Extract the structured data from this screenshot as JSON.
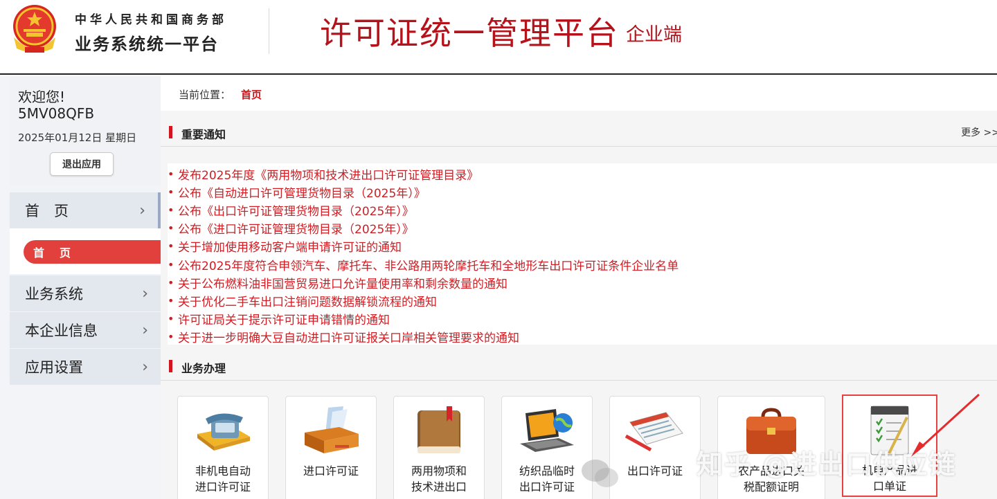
{
  "header": {
    "ministry": "中华人民共和国商务部",
    "platform": "业务系统统一平台",
    "title": "许可证统一管理平台",
    "title_suffix": "企业端"
  },
  "sidebar": {
    "welcome": "欢迎您!",
    "user_id": "5MV08QFB",
    "date": "2025年01月12日 星期日",
    "logout_label": "退出应用",
    "menu": [
      {
        "label": "首　页"
      },
      {
        "label": "业务系统"
      },
      {
        "label": "本企业信息"
      },
      {
        "label": "应用设置"
      }
    ],
    "submenu_active": "首页"
  },
  "breadcrumb": {
    "label": "当前位置：",
    "current": "首页"
  },
  "notices": {
    "title": "重要通知",
    "more": "更多 >>",
    "items": [
      "发布2025年度《两用物项和技术进出口许可证管理目录》",
      "公布《自动进口许可管理货物目录（2025年）》",
      "公布《出口许可证管理货物目录（2025年）》",
      "公布《进口许可证管理货物目录（2025年）》",
      "关于增加使用移动客户端申请许可证的通知",
      "公布2025年度符合申领汽车、摩托车、非公路用两轮摩托车和全地形车出口许可证条件企业名单",
      "关于公布燃料油非国营贸易进口允许量使用率和剩余数量的通知",
      "关于优化二手车出口注销问题数据解锁流程的通知",
      "许可证局关于提示许可证申请错情的通知",
      "关于进一步明确大豆自动进口许可证报关口岸相关管理要求的通知"
    ]
  },
  "business": {
    "title": "业务办理",
    "cards": [
      {
        "line1": "非机电自动",
        "line2": "进口许可证",
        "icon": "telephone-icon"
      },
      {
        "line1": "进口许可证",
        "line2": "",
        "icon": "inbox-tray-icon"
      },
      {
        "line1": "两用物项和",
        "line2": "技术进出口",
        "icon": "book-icon"
      },
      {
        "line1": "纺织品临时",
        "line2": "出口许可证",
        "icon": "laptop-globe-icon"
      },
      {
        "line1": "出口许可证",
        "line2": "",
        "icon": "document-pen-icon"
      },
      {
        "line1": "农产品进口关",
        "line2": "税配额证明",
        "icon": "briefcase-icon"
      },
      {
        "line1": "机电产品进",
        "line2": "口单证",
        "icon": "notebook-checklist-icon"
      }
    ]
  },
  "watermark": "知乎 @进出口供应链",
  "colors": {
    "brand_red": "#b5131b",
    "notice_red": "#cf1d23",
    "active_pill": "#e2403c"
  }
}
